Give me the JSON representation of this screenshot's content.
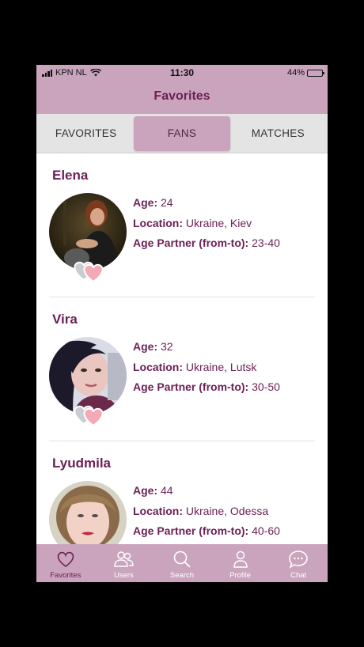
{
  "status_bar": {
    "carrier": "KPN NL",
    "time": "11:30",
    "battery": "44%",
    "battery_level": 0.44
  },
  "header": {
    "title": "Favorites"
  },
  "tabs": [
    {
      "label": "FAVORITES",
      "active": false
    },
    {
      "label": "FANS",
      "active": true
    },
    {
      "label": "MATCHES",
      "active": false
    }
  ],
  "fields": {
    "age": "Age:",
    "location": "Location:",
    "age_partner": "Age Partner (from-to):"
  },
  "profiles": [
    {
      "name": "Elena",
      "age": "24",
      "location": "Ukraine, Kiev",
      "age_partner": "23-40"
    },
    {
      "name": "Vira",
      "age": "32",
      "location": "Ukraine, Lutsk",
      "age_partner": "30-50"
    },
    {
      "name": "Lyudmila",
      "age": "44",
      "location": "Ukraine, Odessa",
      "age_partner": "40-60"
    }
  ],
  "nav": [
    {
      "label": "Favorites",
      "icon": "heart-icon",
      "active": true
    },
    {
      "label": "Users",
      "icon": "users-icon",
      "active": false
    },
    {
      "label": "Search",
      "icon": "search-icon",
      "active": false
    },
    {
      "label": "Profile",
      "icon": "person-icon",
      "active": false
    },
    {
      "label": "Chat",
      "icon": "chat-icon",
      "active": false
    }
  ],
  "colors": {
    "brand": "#caa4bd",
    "accent_text": "#6b1f55",
    "tab_bar_bg": "#e4e4e4"
  }
}
